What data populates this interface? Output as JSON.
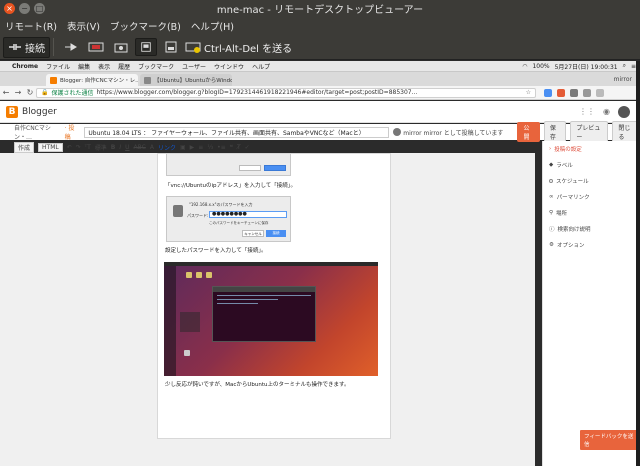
{
  "window": {
    "title": "mne-mac - リモートデスクトップビューアー",
    "close": "×",
    "minimize": "−",
    "maximize": "□"
  },
  "menubar": {
    "items": [
      "リモート(R)",
      "表示(V)",
      "ブックマーク(B)",
      "ヘルプ(H)"
    ]
  },
  "toolbar": {
    "connect_label": "接続",
    "ctrl_alt_del_label": "Ctrl-Alt-Del を送る"
  },
  "mac": {
    "apple": "",
    "menus": [
      "Chrome",
      "ファイル",
      "編集",
      "表示",
      "履歴",
      "ブックマーク",
      "ユーザー",
      "ウインドウ",
      "ヘルプ"
    ],
    "battery": "100%",
    "datetime": "5月27日(日) 19:00:31",
    "user": "mirror"
  },
  "chrome": {
    "tabs": [
      {
        "label": "Blogger: 自作CNCマシン・レ… ×"
      },
      {
        "label": "【Ubuntu】UbuntuからWindo… ×"
      }
    ],
    "profile": "mirror",
    "secure_label": "保護された通信",
    "url": "https://www.blogger.com/blogger.g?blogID=1792314461918221946#editor/target=post;postID=885307..."
  },
  "blogger": {
    "logo": "B",
    "name": "Blogger",
    "breadcrumb_blog": "自作CNCマシン・…",
    "breadcrumb_kind": "· 投稿",
    "post_title": "Ubuntu 18.04 LTS ： ファイヤーウォール、ファイル共有、画面共有、SambaやVNCなど（Macと）",
    "share_text": "mirror mirror として投稿しています",
    "publish": "公開",
    "save": "保存",
    "preview": "プレビュー",
    "close": "閉じる"
  },
  "editor": {
    "mode_compose": "作成",
    "mode_html": "HTML",
    "font_label": "標準",
    "link_label": "リンク"
  },
  "post": {
    "dialog1_btn_cancel": "キャンセル",
    "dialog1_btn_ok": "接続",
    "caption1": "「vnc://Ubuntuのipアドレス」を入力して「接続」。",
    "dialog2_title": "\"192.168.x.x\"のパスワードを入力",
    "dialog2_label": "パスワード:",
    "dialog2_value": "●●●●●●●●",
    "dialog2_check": "このパスワードをキーチェーンに保存",
    "dialog2_cancel": "キャンセル",
    "dialog2_ok": "接続",
    "caption2": "設定したパスワードを入力して「接続」。",
    "caption3": "少し反応が鈍いですが、MacからUbuntu上のターミナルも操作できます。"
  },
  "settings": {
    "header": "投稿の設定",
    "items": [
      "ラベル",
      "スケジュール",
      "パーマリンク",
      "場所",
      "検索向け説明",
      "オプション"
    ]
  },
  "feedback": "フィードバックを送信"
}
